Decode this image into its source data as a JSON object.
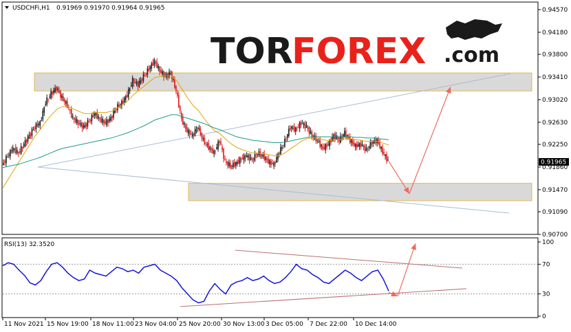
{
  "header": {
    "symbol": "USDCHFi,H1",
    "ohlc": "0.91969 0.91970 0.91964 0.91965"
  },
  "logo": {
    "part1": "TOR",
    "part2": "FOREX",
    "part3": ".com"
  },
  "rsi_header": "RSI(13) 32.3520",
  "current_price": "0.91965",
  "colors": {
    "bull": "#1a1a1a",
    "bear": "#e0191b",
    "ma_fast": "#e0a400",
    "ma_slow": "#1a9a8c",
    "rsi": "#1414d8",
    "zone": "#d9d9d9",
    "zone_border": "#e6b84c",
    "arrow": "#ee6a5e",
    "trendline": "#a8bcd0",
    "rsi_trend": "#b87070"
  },
  "chart_data": [
    {
      "type": "line",
      "name": "USDCHF H1 price",
      "x_labels": [
        "11 Nov 2021",
        "15 Nov 19:00",
        "18 Nov 11:00",
        "23 Nov 04:00",
        "25 Nov 20:00",
        "30 Nov 13:00",
        "3 Dec 05:00",
        "7 Dec 22:00",
        "10 Dec 14:00"
      ],
      "y_ticks": [
        "0.94570",
        "0.94180",
        "0.93800",
        "0.93410",
        "0.93020",
        "0.92630",
        "0.92250",
        "0.91860",
        "0.91470",
        "0.91090",
        "0.90700"
      ],
      "ylim": [
        0.907,
        0.9457
      ],
      "series": [
        {
          "values": [
            0.9189,
            0.9205,
            0.9218,
            0.921,
            0.9225,
            0.924,
            0.9255,
            0.9262,
            0.9298,
            0.9312,
            0.9322,
            0.9305,
            0.9292,
            0.927,
            0.9262,
            0.9255,
            0.9265,
            0.9278,
            0.9268,
            0.9262,
            0.927,
            0.9288,
            0.9296,
            0.931,
            0.9335,
            0.9328,
            0.9342,
            0.9355,
            0.9368,
            0.9352,
            0.9342,
            0.9348,
            0.9318,
            0.9268,
            0.9248,
            0.924,
            0.9255,
            0.9232,
            0.922,
            0.921,
            0.9232,
            0.9195,
            0.9188,
            0.9192,
            0.92,
            0.9205,
            0.9198,
            0.921,
            0.9205,
            0.9195,
            0.919,
            0.9212,
            0.923,
            0.9255,
            0.925,
            0.9262,
            0.9255,
            0.924,
            0.9232,
            0.9218,
            0.9225,
            0.924,
            0.9232,
            0.9245,
            0.9232,
            0.9222,
            0.9225,
            0.9215,
            0.9228,
            0.9232,
            0.9212,
            0.9196
          ]
        },
        {
          "name": "MA fast",
          "values": [
            0.915,
            0.9165,
            0.918,
            0.9195,
            0.921,
            0.9225,
            0.924,
            0.9252,
            0.9265,
            0.9276,
            0.9286,
            0.929,
            0.929,
            0.9286,
            0.9282,
            0.9278,
            0.9278,
            0.928,
            0.928,
            0.928,
            0.9282,
            0.9287,
            0.9293,
            0.93,
            0.931,
            0.9318,
            0.9325,
            0.9333,
            0.934,
            0.9342,
            0.9343,
            0.9343,
            0.9335,
            0.932,
            0.9305,
            0.9292,
            0.9283,
            0.927,
            0.9258,
            0.9248,
            0.9243,
            0.9234,
            0.9226,
            0.922,
            0.9216,
            0.9213,
            0.921,
            0.921,
            0.9209,
            0.9207,
            0.9205,
            0.9206,
            0.9211,
            0.9218,
            0.9224,
            0.9231,
            0.9235,
            0.9236,
            0.9236,
            0.9233,
            0.9231,
            0.9233,
            0.9233,
            0.9235,
            0.9235,
            0.9233,
            0.9232,
            0.923,
            0.923,
            0.923,
            0.9227,
            0.9224
          ]
        },
        {
          "name": "MA slow",
          "values": [
            0.9185,
            0.9187,
            0.9189,
            0.9191,
            0.9194,
            0.9197,
            0.92,
            0.9203,
            0.9207,
            0.9211,
            0.9215,
            0.9218,
            0.922,
            0.9222,
            0.9224,
            0.9226,
            0.9228,
            0.923,
            0.9232,
            0.9234,
            0.9236,
            0.9239,
            0.9242,
            0.9245,
            0.9249,
            0.9253,
            0.9257,
            0.9262,
            0.9267,
            0.927,
            0.9273,
            0.9276,
            0.9276,
            0.9273,
            0.927,
            0.9267,
            0.9264,
            0.9261,
            0.9257,
            0.9253,
            0.925,
            0.9246,
            0.9242,
            0.9238,
            0.9236,
            0.9234,
            0.9232,
            0.9231,
            0.923,
            0.9229,
            0.9228,
            0.9228,
            0.9229,
            0.9231,
            0.9233,
            0.9235,
            0.9237,
            0.9238,
            0.9238,
            0.9238,
            0.9238,
            0.9238,
            0.9238,
            0.9238,
            0.9238,
            0.9237,
            0.9237,
            0.9236,
            0.9236,
            0.9235,
            0.9234,
            0.9233
          ]
        }
      ],
      "resistance_zone": [
        0.9317,
        0.9348
      ],
      "support_zone": [
        0.9128,
        0.9158
      ],
      "forecast_path": [
        0.9196,
        0.914,
        0.9324
      ]
    },
    {
      "type": "line",
      "name": "RSI(13)",
      "y_ticks": [
        "100",
        "70",
        "30",
        "0"
      ],
      "ylim": [
        0,
        100
      ],
      "series": [
        {
          "values": [
            68,
            72,
            70,
            62,
            55,
            45,
            42,
            48,
            60,
            70,
            72,
            66,
            58,
            52,
            48,
            50,
            62,
            58,
            56,
            54,
            60,
            66,
            64,
            60,
            62,
            58,
            66,
            68,
            70,
            62,
            58,
            54,
            48,
            38,
            30,
            22,
            18,
            20,
            34,
            44,
            36,
            30,
            42,
            46,
            48,
            52,
            48,
            50,
            54,
            48,
            44,
            46,
            52,
            60,
            70,
            64,
            62,
            56,
            52,
            46,
            44,
            50,
            56,
            62,
            58,
            52,
            48,
            54,
            60,
            62,
            50,
            34
          ]
        }
      ],
      "levels": [
        70,
        30
      ]
    }
  ]
}
